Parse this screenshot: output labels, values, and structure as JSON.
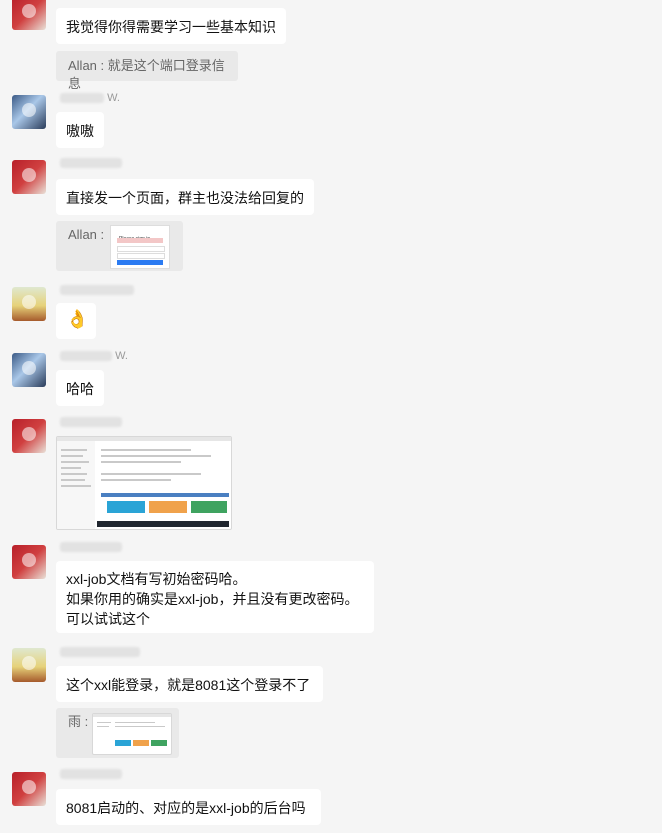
{
  "messages": [
    {
      "text": "我觉得你得需要学习一些基本知识"
    },
    {
      "quote": "Allan : 就是这个端口登录信息"
    },
    {
      "name": "W.",
      "text": "嗷嗷"
    },
    {
      "text": "直接发一个页面，群主也没法给回复的"
    },
    {
      "quote_label": "Allan :",
      "login_title": "Please sign in"
    },
    {
      "emoji": "👌"
    },
    {
      "name": "W.",
      "text": "哈哈"
    },
    {
      "text_lines": [
        "xxl-job文档有写初始密码哈。",
        "如果你用的确实是xxl-job，并且没有更改密码。",
        "可以试试这个"
      ]
    },
    {
      "text": "这个xxl能登录，就是8081这个登录不了"
    },
    {
      "quote_label": "雨 :"
    },
    {
      "text": "8081启动的、对应的是xxl-job的后台吗"
    }
  ],
  "colors": {
    "bg": "#f5f5f5",
    "bubble": "#ffffff",
    "quote_bg": "#e9e9e9",
    "accent_blue": "#2b7bf2"
  }
}
